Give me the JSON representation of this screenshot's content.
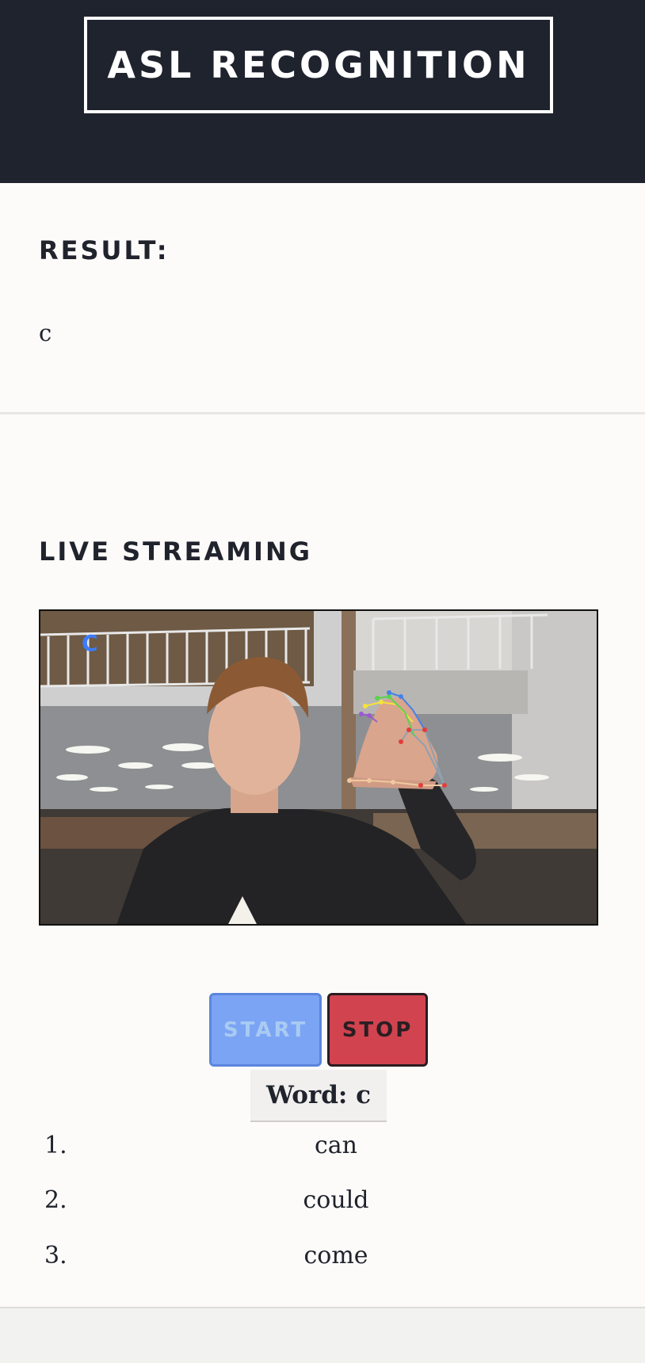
{
  "header": {
    "title": "ASL RECOGNITION"
  },
  "result": {
    "heading": "RESULT:",
    "value": "c"
  },
  "stream": {
    "heading": "LIVE STREAMING",
    "overlay_letter": "C"
  },
  "controls": {
    "start_label": "START",
    "stop_label": "STOP"
  },
  "word": {
    "label": "Word: c"
  },
  "suggestions": [
    {
      "number": "1.",
      "word": "can"
    },
    {
      "number": "2.",
      "word": "could"
    },
    {
      "number": "3.",
      "word": "come"
    }
  ],
  "colors": {
    "header_bg": "#1f232e",
    "start_button": "#7ba4f4",
    "stop_button": "#d0434f"
  }
}
